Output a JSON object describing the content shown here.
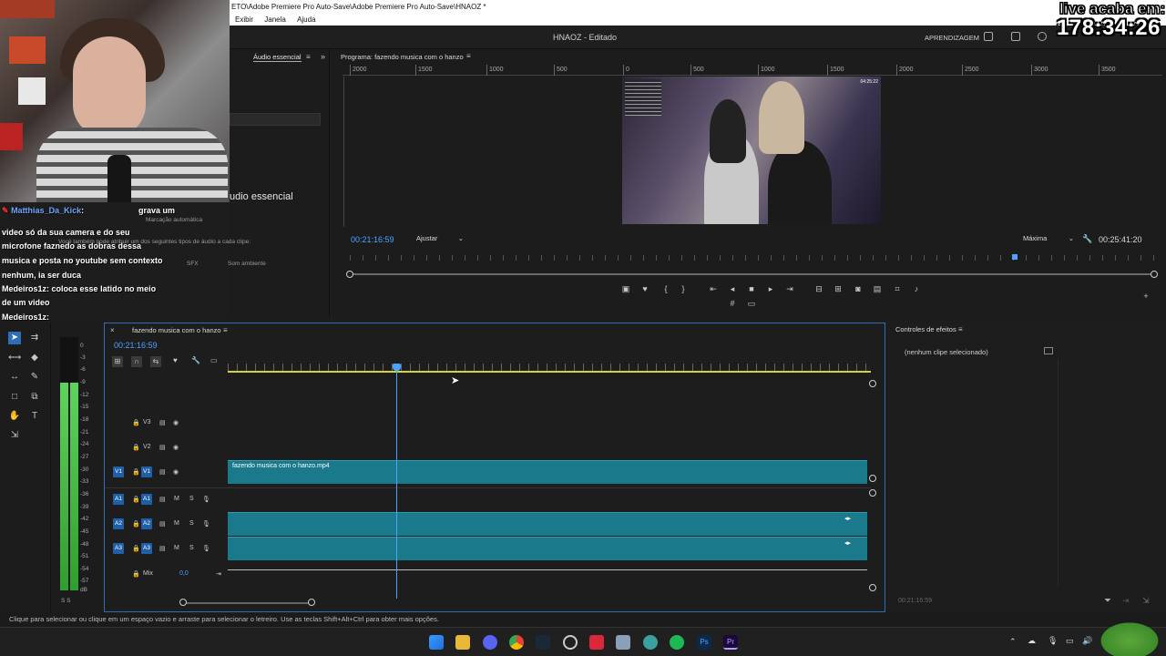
{
  "window": {
    "title": "ETO\\Adobe Premiere Pro Auto-Save\\Adobe Premiere Pro Auto-Save\\HNAOZ *",
    "menu": [
      "Exibir",
      "Janela",
      "Ajuda"
    ],
    "project_title": "HNAOZ - Editado",
    "workspace_label": "APRENDIZAGEM"
  },
  "stream_overlay": {
    "live_label": "live acaba em:",
    "timer": "178:34:26"
  },
  "chat": {
    "lines": [
      {
        "user": "Matthias_Da_Kick",
        "text": "grava um"
      },
      {
        "user": "",
        "text": "video só da sua camera e do seu"
      },
      {
        "user": "",
        "text": "microfone faznedo as dobras dessa"
      },
      {
        "user": "",
        "text": "musica e posta no youtube sem contexto"
      },
      {
        "user": "",
        "text": "nenhum, ia ser duca"
      },
      {
        "user": "Medeiros1z",
        "text": "coloca esse latido no meio"
      },
      {
        "user": "",
        "text": "de um video"
      },
      {
        "user": "Medeiros1z",
        "text": ""
      }
    ]
  },
  "audio_panel": {
    "tab": "Áudio essencial",
    "title": "udio essencial",
    "auto_tag": "Marcação automática",
    "desc": "Você também pode atribuir um dos seguintes tipos de áudio a cada clipe:",
    "sfx": "SFX",
    "ambient": "Som ambiente"
  },
  "program_monitor": {
    "tab": "Programa: fazendo musica com o hanzo",
    "ruler_ticks": [
      "2000",
      "1500",
      "1000",
      "500",
      "0",
      "500",
      "1000",
      "1500",
      "2000",
      "2500",
      "3000",
      "3500"
    ],
    "timecode_current": "00:21:16:59",
    "fit": "Ajustar",
    "quality": "Máxima",
    "timecode_duration": "00:25:41:20",
    "video_time": "04:25:22"
  },
  "timeline": {
    "tab": "fazendo musica com o hanzo",
    "timecode": "00:21:16:59",
    "video_tracks": [
      "V3",
      "V2",
      "V1"
    ],
    "audio_tracks": [
      "A1",
      "A2",
      "A3"
    ],
    "mix_label": "Mix",
    "mix_value": "0,0",
    "clip_name": "fazendo musica com o hanzo.mp4",
    "track_m": "M",
    "track_s": "S"
  },
  "meter": {
    "db_labels": [
      "0",
      "-6",
      "-12",
      "-18",
      "-24",
      "-30",
      "-36",
      "-42",
      "-48",
      "-54",
      "dB"
    ],
    "db_labels_more": [
      "-3",
      "-9",
      "-15",
      "-21",
      "-27",
      "-33",
      "-39",
      "-45",
      "-51",
      "-57"
    ],
    "bottom": "S S"
  },
  "effects": {
    "tab": "Controles de efeitos",
    "empty": "(nenhum clipe selecionado)",
    "time": "00:21:16:59"
  },
  "status_bar": {
    "text": "Clique para selecionar ou clique em um espaço vazio e arraste para selecionar o letreiro. Use as teclas Shift+Alt+Ctrl para obter mais opções."
  },
  "colors": {
    "accent": "#4aa3ff",
    "clip": "#1a7a8c",
    "panel": "#1d1d1d"
  }
}
